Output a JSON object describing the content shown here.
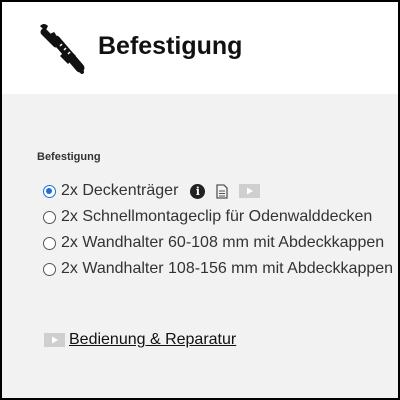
{
  "header": {
    "title": "Befestigung",
    "icon": "screwdriver-wrench-icon"
  },
  "section": {
    "label": "Befestigung"
  },
  "options": [
    {
      "label": "2x Deckenträger",
      "checked": true,
      "icons": [
        "info-icon",
        "document-icon",
        "video-icon"
      ]
    },
    {
      "label": "2x Schnellmontageclip für Odenwalddecken",
      "checked": false
    },
    {
      "label": "2x Wandhalter 60-108 mm mit Abdeckkappen",
      "checked": false
    },
    {
      "label": "2x Wandhalter 108-156 mm mit Abdeckkappen",
      "checked": false
    }
  ],
  "link": {
    "label": "Bedienung & Reparatur",
    "icon": "video-icon"
  },
  "colors": {
    "accent": "#1f6fd6",
    "header_bg": "#ffffff",
    "content_bg": "#f2f2f2"
  }
}
